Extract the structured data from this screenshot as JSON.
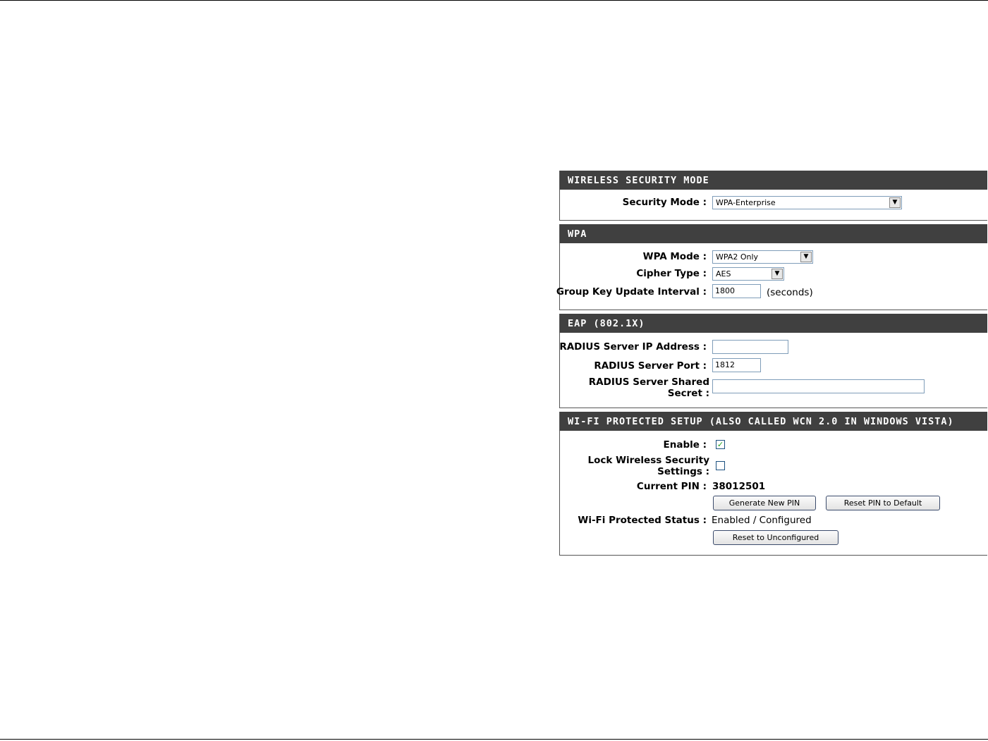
{
  "sections": {
    "security_mode": {
      "title": "WIRELESS SECURITY MODE",
      "security_mode_label": "Security Mode :",
      "security_mode_value": "WPA-Enterprise"
    },
    "wpa": {
      "title": "WPA",
      "wpa_mode_label": "WPA Mode :",
      "wpa_mode_value": "WPA2 Only",
      "cipher_type_label": "Cipher Type :",
      "cipher_type_value": "AES",
      "group_key_label": "Group Key Update Interval :",
      "group_key_value": "1800",
      "group_key_unit": "(seconds)"
    },
    "eap": {
      "title": "EAP (802.1X)",
      "radius_ip_label": "RADIUS Server IP Address :",
      "radius_ip_value": "",
      "radius_port_label": "RADIUS Server Port :",
      "radius_port_value": "1812",
      "radius_secret_label": "RADIUS Server Shared Secret :",
      "radius_secret_value": ""
    },
    "wps": {
      "title": "WI-FI PROTECTED SETUP (ALSO CALLED WCN 2.0 IN WINDOWS VISTA)",
      "enable_label": "Enable :",
      "enable_checked": true,
      "lock_label": "Lock Wireless Security Settings :",
      "lock_checked": false,
      "current_pin_label": "Current PIN :",
      "current_pin_value": "38012501",
      "generate_pin_button": "Generate New PIN",
      "reset_pin_button": "Reset PIN to Default",
      "status_label": "Wi-Fi Protected Status :",
      "status_value": "Enabled / Configured",
      "reset_unconfigured_button": "Reset to Unconfigured"
    }
  },
  "icons": {
    "dropdown_arrow": "chevron-down-icon",
    "checkmark": "check-icon"
  },
  "colors": {
    "header_bg": "#404040",
    "header_text": "#ffffff",
    "checkmark": "#21a121"
  }
}
